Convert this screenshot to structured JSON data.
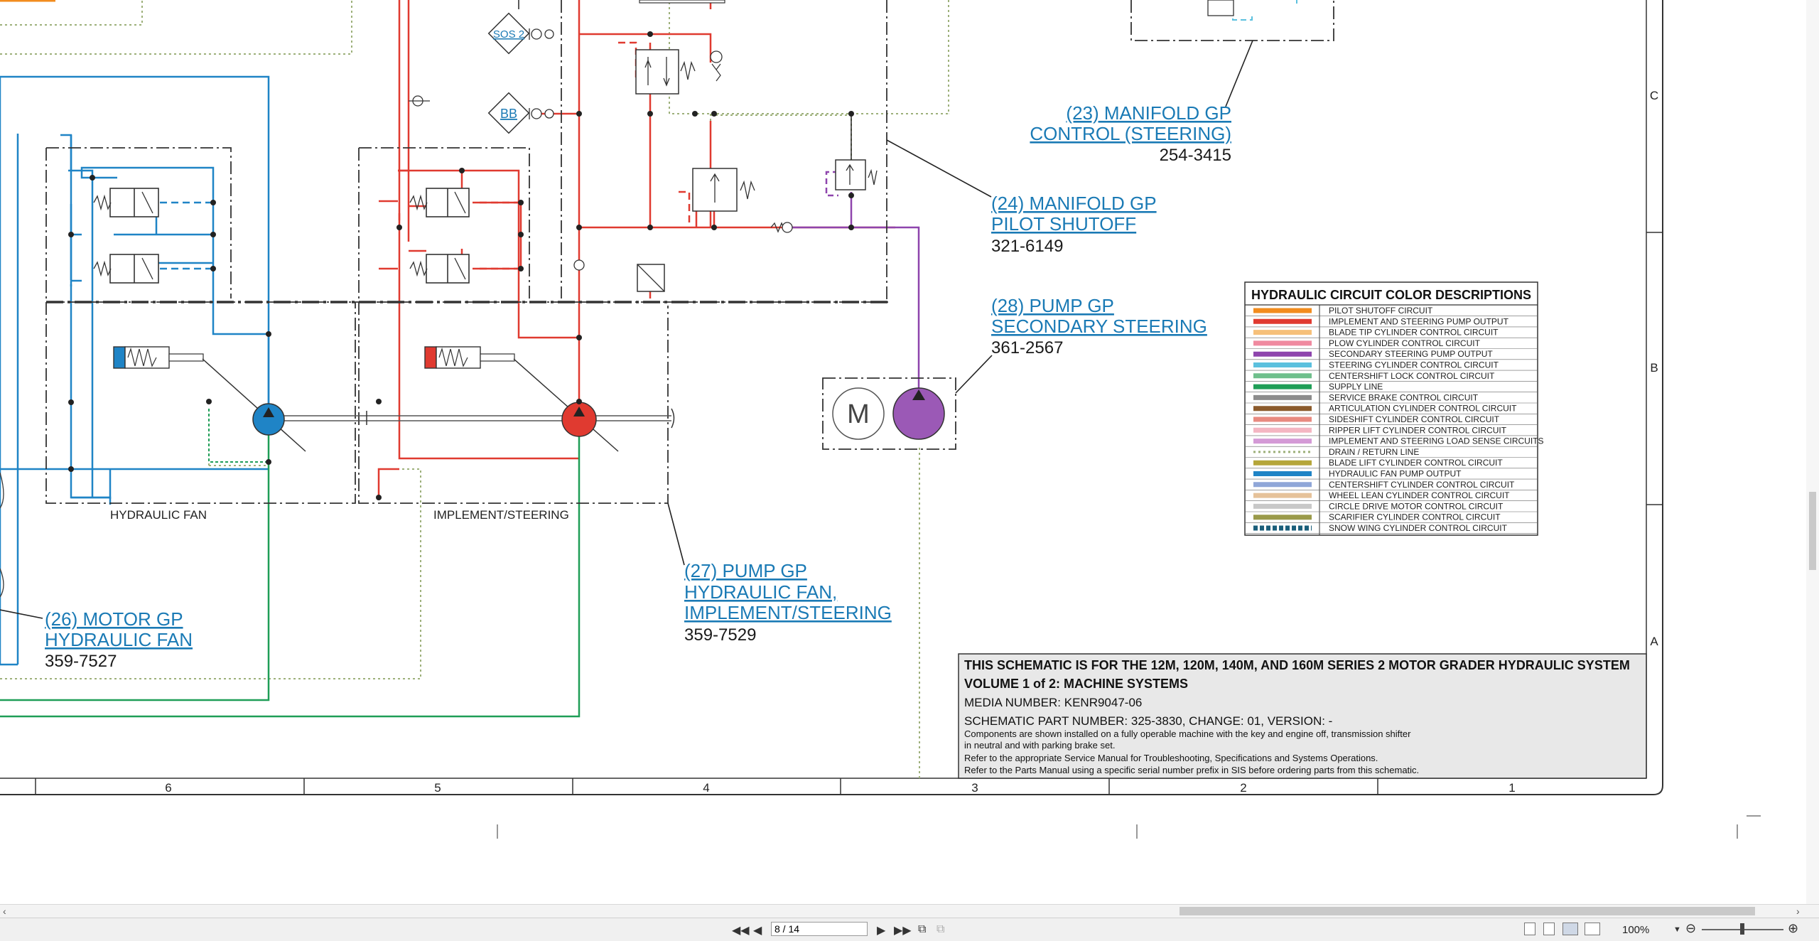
{
  "schematic": {
    "valves": {
      "sos2": "SOS 2",
      "bb": "BB"
    },
    "callouts": {
      "c23": {
        "line1": "(23) MANIFOLD GP",
        "line2": "CONTROL (STEERING)",
        "part": "254-3415"
      },
      "c24": {
        "line1": "(24) MANIFOLD GP",
        "line2": "PILOT SHUTOFF",
        "part": "321-6149"
      },
      "c28": {
        "line1": "(28) PUMP GP",
        "line2": "SECONDARY STEERING",
        "part": "361-2567"
      },
      "c27": {
        "line1": "(27) PUMP GP",
        "line2": "HYDRAULIC FAN,",
        "line3": "IMPLEMENT/STEERING",
        "part": "359-7529"
      },
      "c26": {
        "line1": "(26) MOTOR GP",
        "line2": "HYDRAULIC FAN",
        "part": "359-7527"
      }
    },
    "section_labels": {
      "fan": "HYDRAULIC FAN",
      "impl": "IMPLEMENT/STEERING"
    },
    "motor_symbol": "M",
    "legend": {
      "title": "HYDRAULIC CIRCUIT COLOR DESCRIPTIONS",
      "items": [
        {
          "label": "PILOT SHUTOFF CIRCUIT",
          "color": "#f28c1e"
        },
        {
          "label": "IMPLEMENT AND STEERING PUMP OUTPUT",
          "color": "#e03a30"
        },
        {
          "label": "BLADE TIP CYLINDER CONTROL CIRCUIT",
          "color": "#f6c07a"
        },
        {
          "label": "PLOW CYLINDER CONTROL CIRCUIT",
          "color": "#f08aa0"
        },
        {
          "label": "SECONDARY STEERING PUMP OUTPUT",
          "color": "#8e44ad"
        },
        {
          "label": "STEERING CYLINDER CONTROL CIRCUIT",
          "color": "#5bc0de"
        },
        {
          "label": "CENTERSHIFT LOCK CONTROL CIRCUIT",
          "color": "#6fbf8c"
        },
        {
          "label": "SUPPLY LINE",
          "color": "#1f9e57"
        },
        {
          "label": "SERVICE BRAKE CONTROL CIRCUIT",
          "color": "#8c8c8c"
        },
        {
          "label": "ARTICULATION CYLINDER CONTROL CIRCUIT",
          "color": "#8b5a2b"
        },
        {
          "label": "SIDESHIFT CYLINDER CONTROL CIRCUIT",
          "color": "#e88a80"
        },
        {
          "label": "RIPPER LIFT CYLINDER CONTROL CIRCUIT",
          "color": "#f4b6c2"
        },
        {
          "label": "IMPLEMENT AND STEERING LOAD SENSE CIRCUITS",
          "color": "#d49ad6"
        },
        {
          "label": "DRAIN / RETURN LINE",
          "color": "#9db07a"
        },
        {
          "label": "BLADE LIFT CYLINDER CONTROL CIRCUIT",
          "color": "#b5a63a"
        },
        {
          "label": "HYDRAULIC FAN PUMP OUTPUT",
          "color": "#1f84c6"
        },
        {
          "label": "CENTERSHIFT CYLINDER CONTROL CIRCUIT",
          "color": "#8fa6d8"
        },
        {
          "label": "WHEEL LEAN CYLINDER CONTROL CIRCUIT",
          "color": "#e6c29a"
        },
        {
          "label": "CIRCLE DRIVE MOTOR CONTROL CIRCUIT",
          "color": "#c8c8c8"
        },
        {
          "label": "SCARIFIER CYLINDER CONTROL CIRCUIT",
          "color": "#9a9a4a"
        },
        {
          "label": "SNOW WING CYLINDER CONTROL CIRCUIT",
          "color": "#1a5e7a"
        }
      ]
    },
    "title_block": {
      "line1": "THIS SCHEMATIC IS FOR THE 12M, 120M, 140M, AND 160M SERIES 2 MOTOR GRADER HYDRAULIC SYSTEM",
      "line2": "VOLUME 1 of 2: MACHINE SYSTEMS",
      "line3": "MEDIA NUMBER: KENR9047-06",
      "line4": "SCHEMATIC PART NUMBER: 325-3830, CHANGE: 01, VERSION: -",
      "note1": "Components are shown installed on a fully operable machine with the key and engine off, transmission shifter",
      "note2": "in neutral and with parking brake set.",
      "note3": "Refer to the appropriate Service Manual for Troubleshooting, Specifications and Systems Operations.",
      "note4": "Refer to the Parts Manual using a specific serial number prefix in SIS before ordering parts from this schematic."
    },
    "grid_columns": [
      "6",
      "5",
      "4",
      "3",
      "2",
      "1"
    ],
    "grid_rows": [
      "C",
      "B",
      "A"
    ]
  },
  "viewer": {
    "page_field": "8 / 14",
    "zoom_level": "100%",
    "nav": {
      "first_icon": "first-page-icon",
      "prev_icon": "previous-page-icon",
      "next_icon": "next-page-icon",
      "last_icon": "last-page-icon"
    }
  }
}
